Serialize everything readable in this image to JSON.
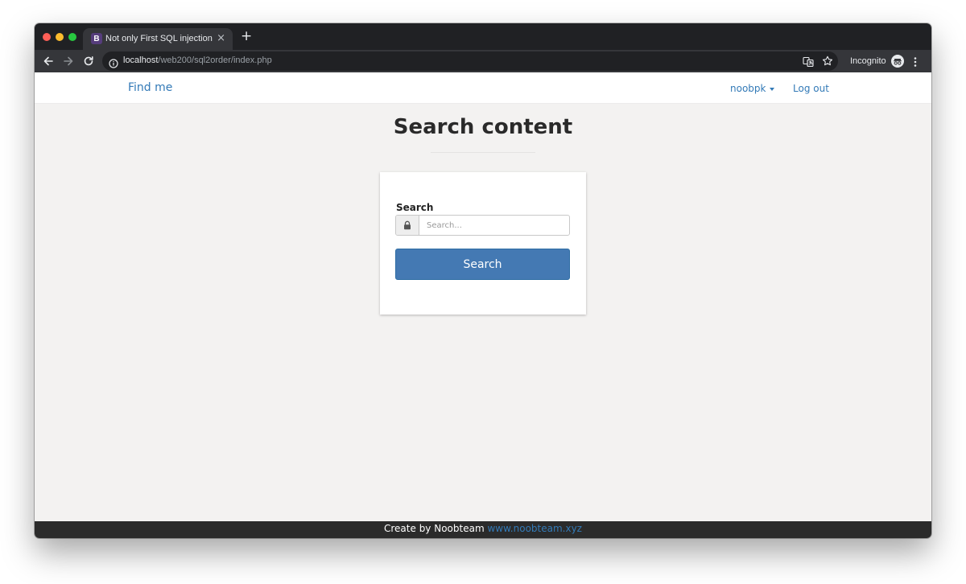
{
  "browser": {
    "tab": {
      "favicon": "B",
      "title": "Not only First SQL injection",
      "close": "×"
    },
    "new_tab": "+",
    "url": {
      "host": "localhost",
      "path": "/web200/sql2order/index.php"
    },
    "incognito_label": "Incognito",
    "icons": [
      "back-arrow-icon",
      "forward-arrow-icon",
      "reload-icon",
      "info-icon",
      "translate-icon",
      "star-icon",
      "incognito-icon",
      "menu-dots-icon"
    ]
  },
  "navbar": {
    "brand": "Find me",
    "user": "noobpk",
    "logout": "Log out"
  },
  "main": {
    "heading": "Search content",
    "form": {
      "label": "Search",
      "placeholder": "Search...",
      "value": "",
      "button": "Search",
      "addon_icon": "lock-icon"
    }
  },
  "footer": {
    "text": "Create by Noobteam",
    "link": "www.noobteam.xyz"
  },
  "colors": {
    "link": "#337ab7",
    "button": "#4479b3",
    "page_bg": "#f3f2f1",
    "footer_bg": "#2b2b2b"
  }
}
